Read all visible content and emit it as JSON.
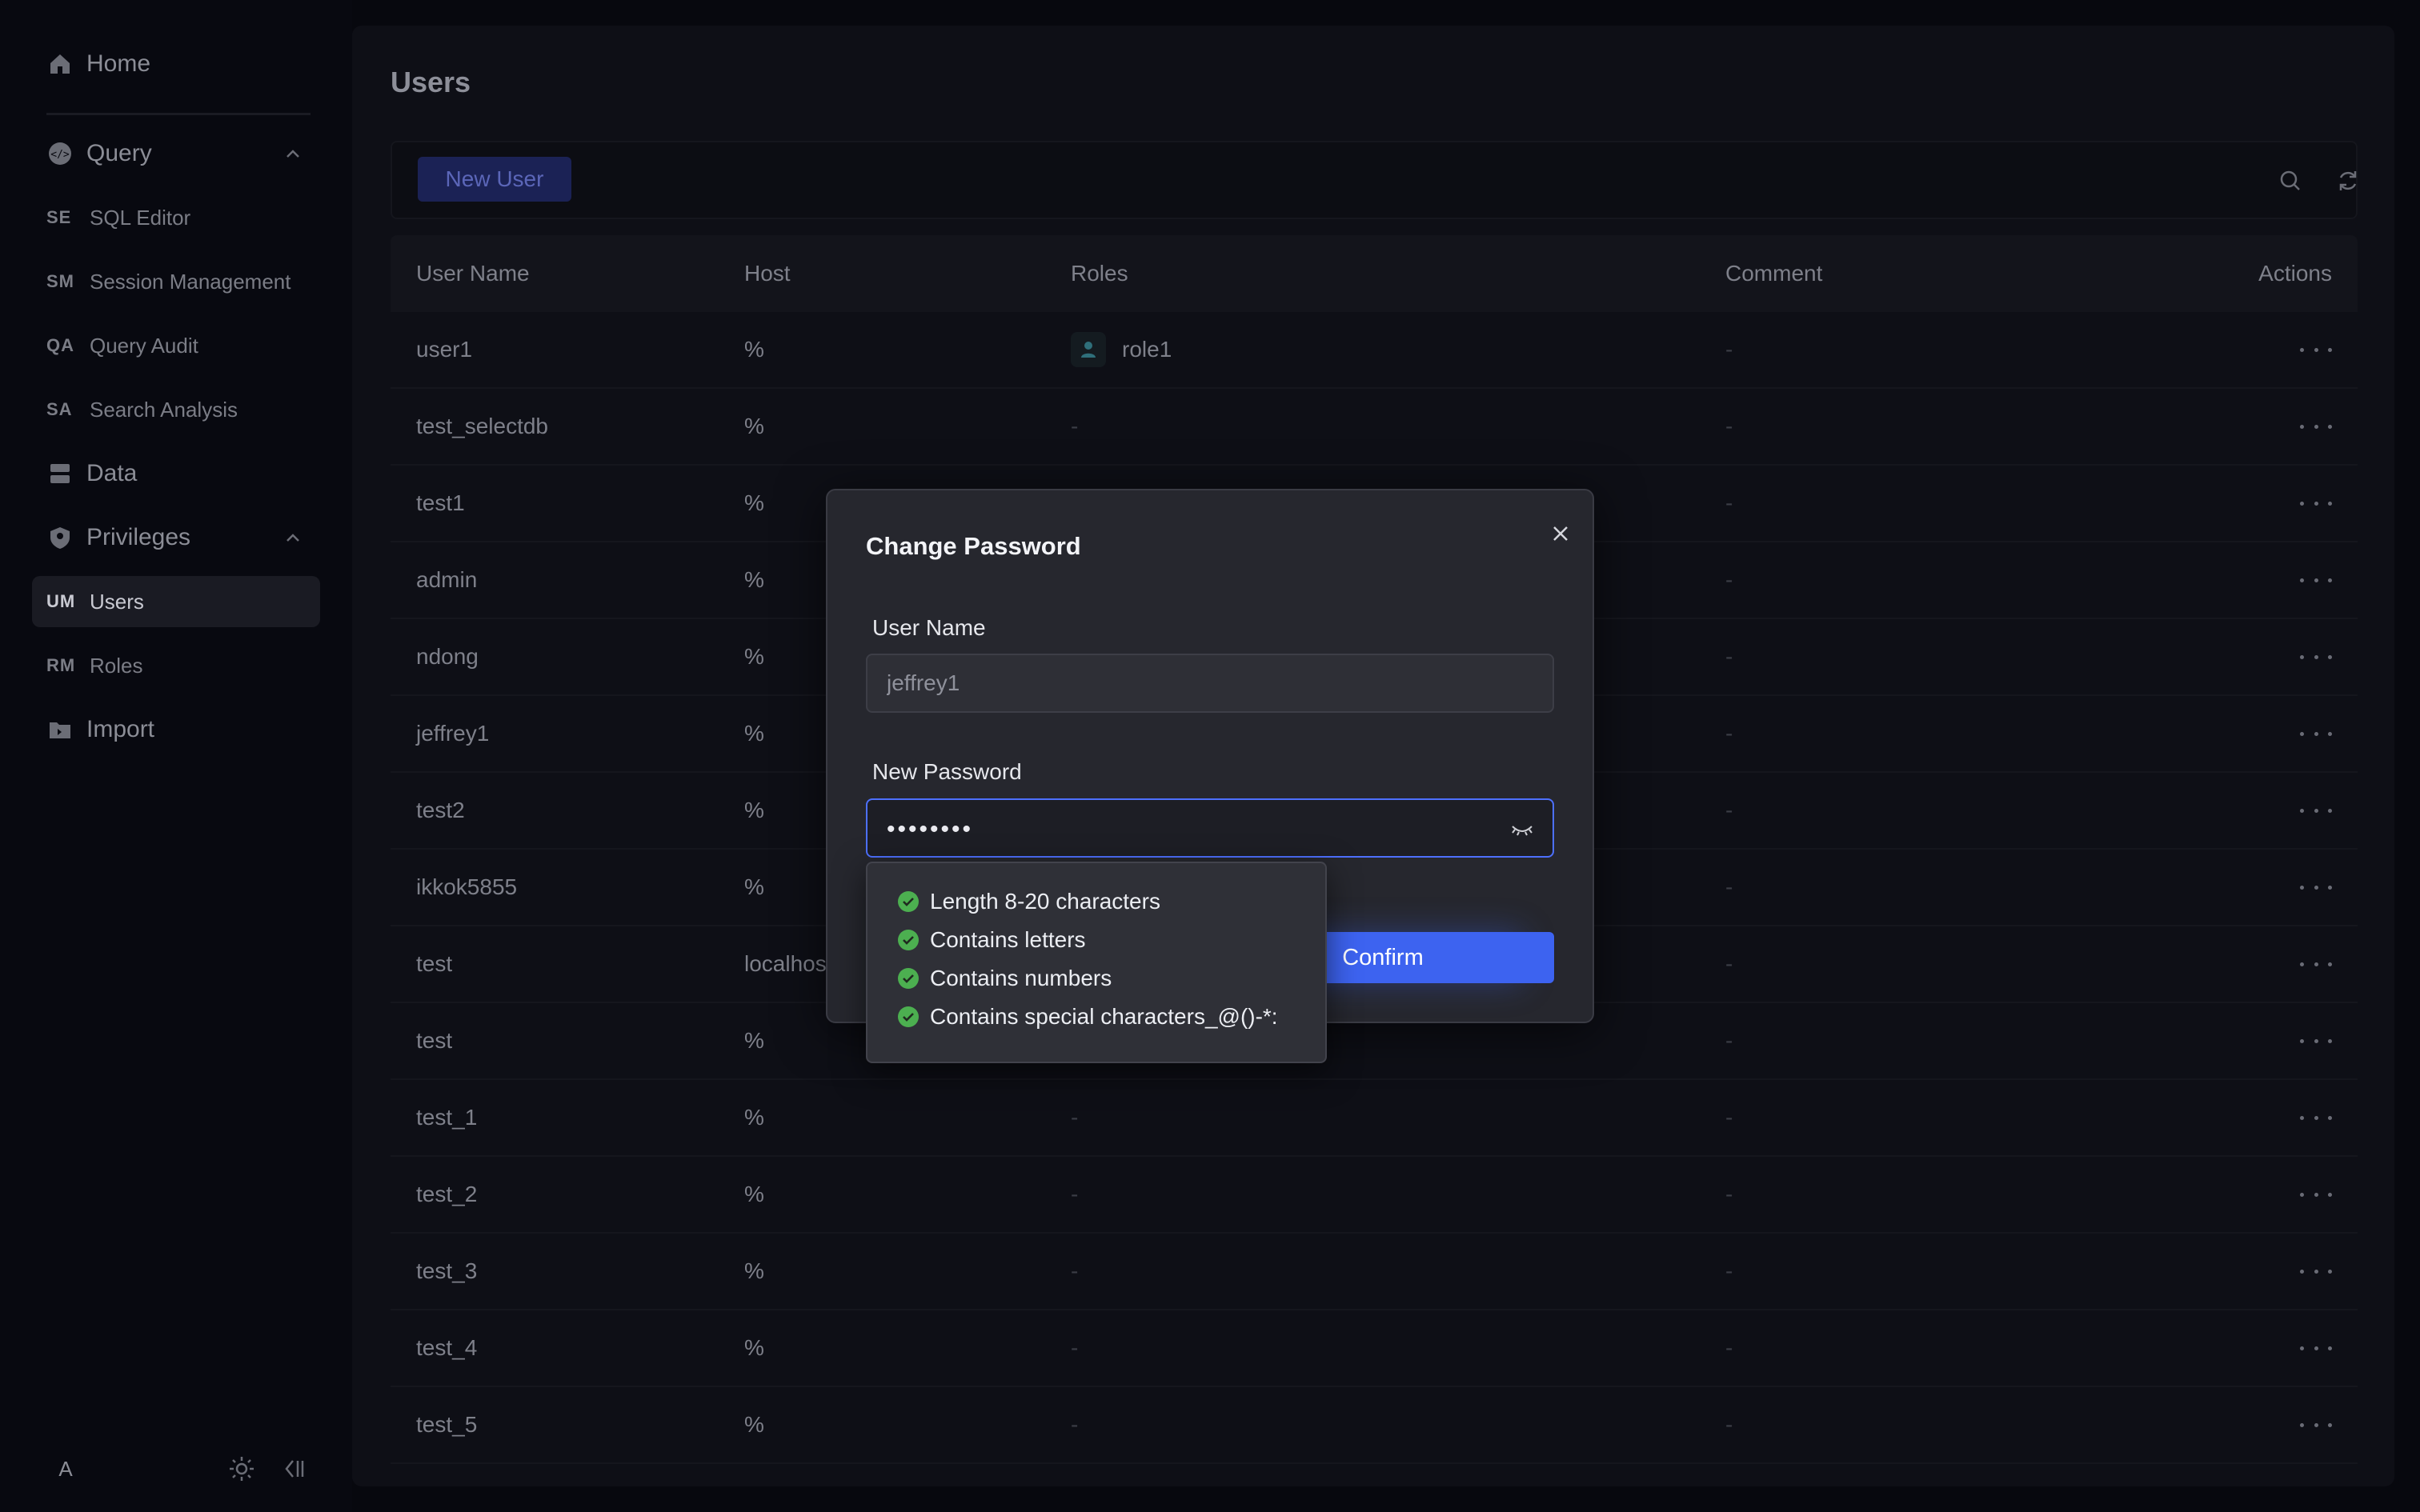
{
  "sidebar": {
    "home": "Home",
    "query": "Query",
    "query_items": [
      {
        "abbr": "SE",
        "label": "SQL Editor"
      },
      {
        "abbr": "SM",
        "label": "Session Management"
      },
      {
        "abbr": "QA",
        "label": "Query Audit"
      },
      {
        "abbr": "SA",
        "label": "Search Analysis"
      }
    ],
    "data": "Data",
    "privileges": "Privileges",
    "privilege_items": [
      {
        "abbr": "UM",
        "label": "Users"
      },
      {
        "abbr": "RM",
        "label": "Roles"
      }
    ],
    "import": "Import",
    "avatar": "A"
  },
  "page": {
    "title": "Users",
    "new_user_label": "New User"
  },
  "table": {
    "headers": {
      "name": "User Name",
      "host": "Host",
      "roles": "Roles",
      "comment": "Comment",
      "actions": "Actions"
    },
    "rows": [
      {
        "name": "user1",
        "host": "%",
        "roles": "role1",
        "comment": "-"
      },
      {
        "name": "test_selectdb",
        "host": "%",
        "roles": "-",
        "comment": "-"
      },
      {
        "name": "test1",
        "host": "%",
        "roles": "",
        "comment": "-"
      },
      {
        "name": "admin",
        "host": "%",
        "roles": "",
        "comment": "-"
      },
      {
        "name": "ndong",
        "host": "%",
        "roles": "",
        "comment": "-"
      },
      {
        "name": "jeffrey1",
        "host": "%",
        "roles": "",
        "comment": "-"
      },
      {
        "name": "test2",
        "host": "%",
        "roles": "",
        "comment": "-"
      },
      {
        "name": "ikkok5855",
        "host": "%",
        "roles": "",
        "comment": "-"
      },
      {
        "name": "test",
        "host": "localhost",
        "roles": "",
        "comment": "-"
      },
      {
        "name": "test",
        "host": "%",
        "roles": "",
        "comment": "-"
      },
      {
        "name": "test_1",
        "host": "%",
        "roles": "-",
        "comment": "-"
      },
      {
        "name": "test_2",
        "host": "%",
        "roles": "-",
        "comment": "-"
      },
      {
        "name": "test_3",
        "host": "%",
        "roles": "-",
        "comment": "-"
      },
      {
        "name": "test_4",
        "host": "%",
        "roles": "-",
        "comment": "-"
      },
      {
        "name": "test_5",
        "host": "%",
        "roles": "-",
        "comment": "-"
      }
    ]
  },
  "dialog": {
    "title": "Change Password",
    "username_label": "User Name",
    "username_value": "jeffrey1",
    "password_label": "New Password",
    "password_value": "••••••••",
    "confirm_label": "Confirm",
    "rules": [
      "Length 8-20 characters",
      "Contains letters",
      "Contains numbers",
      "Contains special characters_@()-*:"
    ]
  },
  "colors": {
    "accent": "#3d63f0",
    "focus_border": "#4d70ff",
    "check_green": "#4caf50"
  }
}
